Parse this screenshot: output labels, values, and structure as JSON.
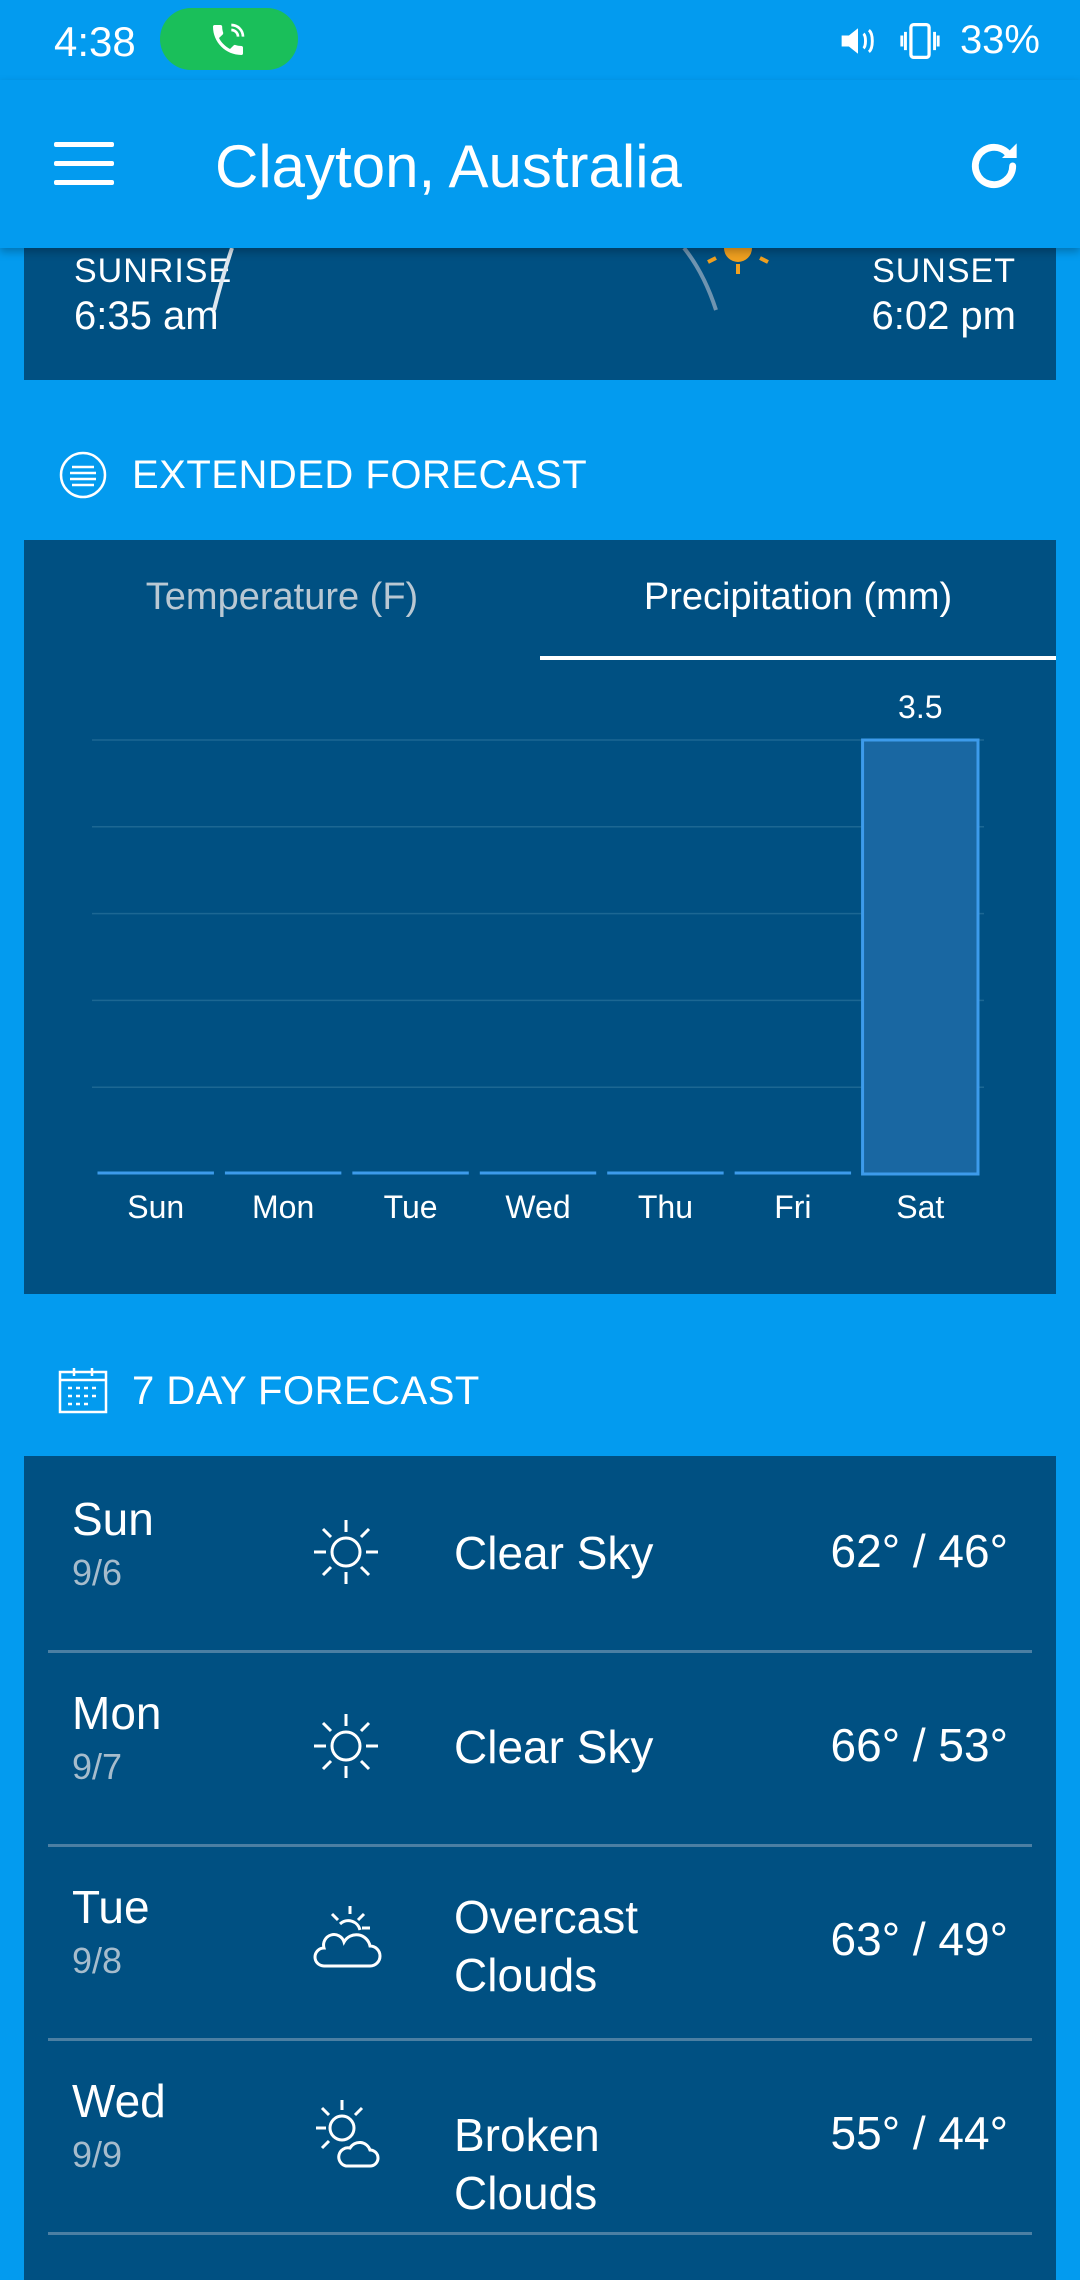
{
  "status": {
    "time": "4:38",
    "battery": "33%"
  },
  "header": {
    "title": "Clayton, Australia"
  },
  "sun": {
    "sunrise_label": "SUNRISE",
    "sunrise_time": "6:35 am",
    "sunset_label": "SUNSET",
    "sunset_time": "6:02 pm"
  },
  "extended": {
    "heading": "EXTENDED FORECAST",
    "tabs": [
      "Temperature (F)",
      "Precipitation (mm)"
    ],
    "active_tab": 1
  },
  "chart_data": {
    "type": "bar",
    "categories": [
      "Sun",
      "Mon",
      "Tue",
      "Wed",
      "Thu",
      "Fri",
      "Sat"
    ],
    "values": [
      0,
      0,
      0,
      0,
      0,
      0,
      3.5
    ],
    "data_labels": [
      "",
      "",
      "",
      "",
      "",
      "",
      "3.5"
    ],
    "ylim": [
      0,
      3.5
    ],
    "grid": true
  },
  "week": {
    "heading": "7 DAY FORECAST",
    "rows": [
      {
        "day": "Sun",
        "date": "9/6",
        "icon": "sun-icon",
        "desc1": "Clear Sky",
        "desc2": "",
        "temp": "62° / 46°"
      },
      {
        "day": "Mon",
        "date": "9/7",
        "icon": "sun-icon",
        "desc1": "Clear Sky",
        "desc2": "",
        "temp": "66° / 53°"
      },
      {
        "day": "Tue",
        "date": "9/8",
        "icon": "overcast-clouds-icon",
        "desc1": "Overcast",
        "desc2": "Clouds",
        "temp": "63° / 49°"
      },
      {
        "day": "Wed",
        "date": "9/9",
        "icon": "broken-clouds-icon",
        "desc1": "Broken Clouds",
        "desc2": "",
        "temp": "55° / 44°"
      }
    ]
  },
  "colors": {
    "background": "#039BEF",
    "card": "#005082",
    "bar_fill": "#1967A2",
    "bar_stroke": "#3D9BEB",
    "call_green": "#1ABF5A"
  }
}
